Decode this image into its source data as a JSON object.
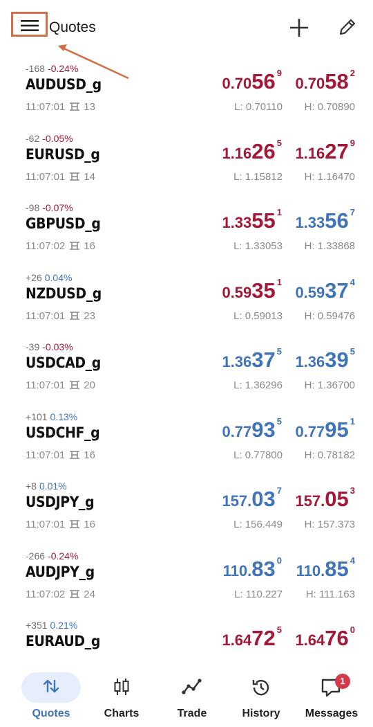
{
  "header": {
    "title": "Quotes",
    "icons": {
      "menu": "hamburger-menu-icon",
      "add": "plus-icon",
      "edit": "pencil-icon"
    }
  },
  "colors": {
    "down": "#a31837",
    "up": "#3f74b9",
    "highlight": "#d0704a"
  },
  "quotes": [
    {
      "symbol": "AUDUSD_g",
      "points": "-168",
      "percent": "-0.24%",
      "dir": "neg",
      "time": "11:07:01",
      "spread": "13",
      "bid": {
        "small": "0.70",
        "big": "56",
        "sup": "9",
        "dir": "down"
      },
      "ask": {
        "small": "0.70",
        "big": "58",
        "sup": "2",
        "dir": "down"
      },
      "low": "L: 0.70110",
      "high": "H: 0.70890"
    },
    {
      "symbol": "EURUSD_g",
      "points": "-62",
      "percent": "-0.05%",
      "dir": "neg",
      "time": "11:07:01",
      "spread": "14",
      "bid": {
        "small": "1.16",
        "big": "26",
        "sup": "5",
        "dir": "down"
      },
      "ask": {
        "small": "1.16",
        "big": "27",
        "sup": "9",
        "dir": "down"
      },
      "low": "L: 1.15812",
      "high": "H: 1.16470"
    },
    {
      "symbol": "GBPUSD_g",
      "points": "-98",
      "percent": "-0.07%",
      "dir": "neg",
      "time": "11:07:02",
      "spread": "16",
      "bid": {
        "small": "1.33",
        "big": "55",
        "sup": "1",
        "dir": "down"
      },
      "ask": {
        "small": "1.33",
        "big": "56",
        "sup": "7",
        "dir": "up"
      },
      "low": "L: 1.33053",
      "high": "H: 1.33868"
    },
    {
      "symbol": "NZDUSD_g",
      "points": "+26",
      "percent": "0.04%",
      "dir": "pos",
      "time": "11:07:01",
      "spread": "23",
      "bid": {
        "small": "0.59",
        "big": "35",
        "sup": "1",
        "dir": "down"
      },
      "ask": {
        "small": "0.59",
        "big": "37",
        "sup": "4",
        "dir": "up"
      },
      "low": "L: 0.59013",
      "high": "H: 0.59476"
    },
    {
      "symbol": "USDCAD_g",
      "points": "-39",
      "percent": "-0.03%",
      "dir": "neg",
      "time": "11:07:01",
      "spread": "20",
      "bid": {
        "small": "1.36",
        "big": "37",
        "sup": "5",
        "dir": "up"
      },
      "ask": {
        "small": "1.36",
        "big": "39",
        "sup": "5",
        "dir": "up"
      },
      "low": "L: 1.36296",
      "high": "H: 1.36700"
    },
    {
      "symbol": "USDCHF_g",
      "points": "+101",
      "percent": "0.13%",
      "dir": "pos",
      "time": "11:07:01",
      "spread": "16",
      "bid": {
        "small": "0.77",
        "big": "93",
        "sup": "5",
        "dir": "up"
      },
      "ask": {
        "small": "0.77",
        "big": "95",
        "sup": "1",
        "dir": "up"
      },
      "low": "L: 0.77800",
      "high": "H: 0.78182"
    },
    {
      "symbol": "USDJPY_g",
      "points": "+8",
      "percent": "0.01%",
      "dir": "pos",
      "time": "11:07:01",
      "spread": "16",
      "bid": {
        "small": "157.",
        "big": "03",
        "sup": "7",
        "dir": "up"
      },
      "ask": {
        "small": "157.",
        "big": "05",
        "sup": "3",
        "dir": "down"
      },
      "low": "L: 156.449",
      "high": "H: 157.373"
    },
    {
      "symbol": "AUDJPY_g",
      "points": "-266",
      "percent": "-0.24%",
      "dir": "neg",
      "time": "11:07:02",
      "spread": "24",
      "bid": {
        "small": "110.",
        "big": "83",
        "sup": "0",
        "dir": "up"
      },
      "ask": {
        "small": "110.",
        "big": "85",
        "sup": "4",
        "dir": "up"
      },
      "low": "L: 110.227",
      "high": "H: 111.163"
    },
    {
      "symbol": "EURAUD_g",
      "points": "+351",
      "percent": "0.21%",
      "dir": "pos",
      "time": "",
      "spread": "",
      "bid": {
        "small": "1.64",
        "big": "72",
        "sup": "5",
        "dir": "down"
      },
      "ask": {
        "small": "1.64",
        "big": "76",
        "sup": "0",
        "dir": "down"
      },
      "low": "",
      "high": ""
    }
  ],
  "tabs": [
    {
      "label": "Quotes",
      "icon": "sort-arrows-icon",
      "active": true
    },
    {
      "label": "Charts",
      "icon": "candlestick-icon",
      "active": false
    },
    {
      "label": "Trade",
      "icon": "trend-line-icon",
      "active": false
    },
    {
      "label": "History",
      "icon": "history-clock-icon",
      "active": false
    },
    {
      "label": "Messages",
      "icon": "chat-bubble-icon",
      "active": false,
      "badge": "1"
    }
  ]
}
